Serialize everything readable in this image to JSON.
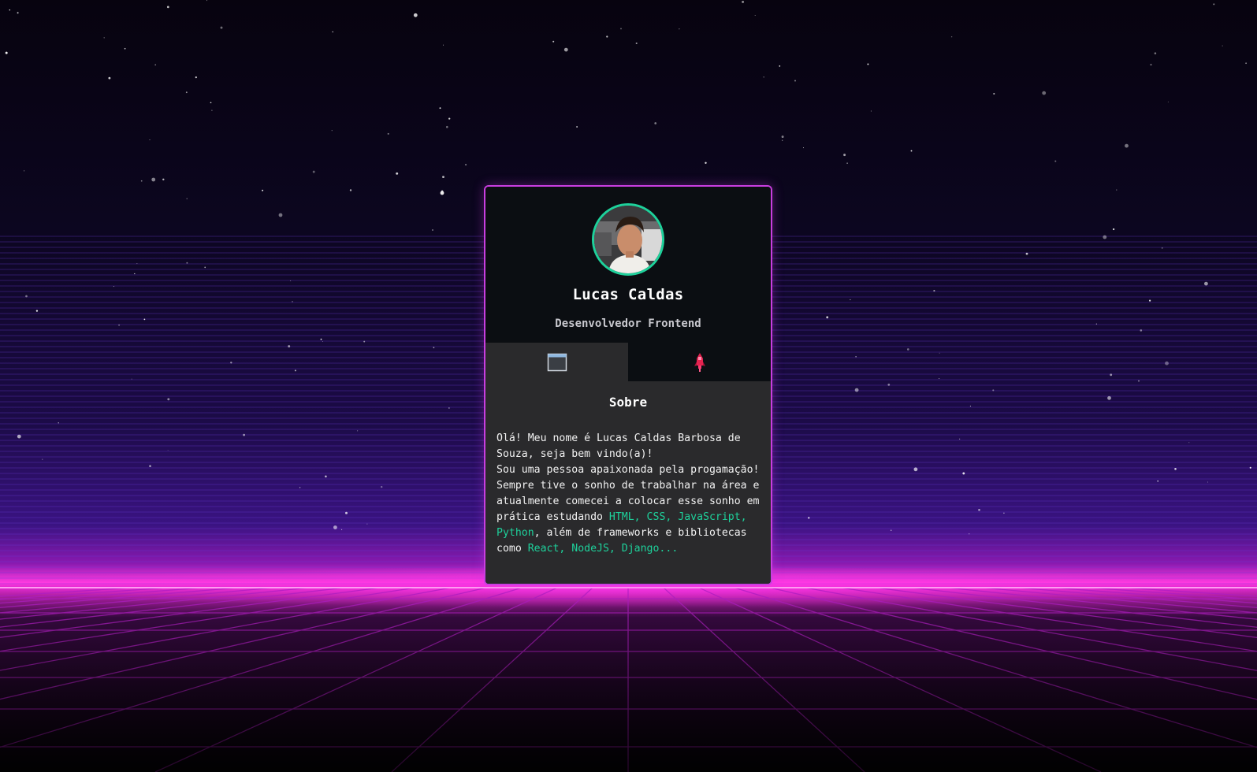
{
  "profile": {
    "name": "Lucas Caldas",
    "role": "Desenvolvedor Frontend",
    "avatar_alt": "profile-photo"
  },
  "tabs": [
    {
      "icon": "window-icon",
      "active": true
    },
    {
      "icon": "rocket-icon",
      "active": false
    }
  ],
  "about": {
    "title": "Sobre",
    "p1": "Olá! Meu nome é Lucas Caldas Barbosa de Souza, seja bem vindo(a)!",
    "p2_start": "Sou uma pessoa apaixonada pela progamação! Sempre tive o sonho de trabalhar na área e atualmente comecei a colocar esse sonho em prática estudando ",
    "skills": "HTML, CSS, JavaScript, Python",
    "p2_mid": ", além de frameworks e bibliotecas como ",
    "libs": "React, NodeJS, Django..."
  },
  "colors": {
    "accent": "#1ed19b",
    "border": "#c93ee0",
    "card_bg": "#0b0e12",
    "content_bg": "#2a2a2c",
    "neon": "#ff2bd6"
  }
}
